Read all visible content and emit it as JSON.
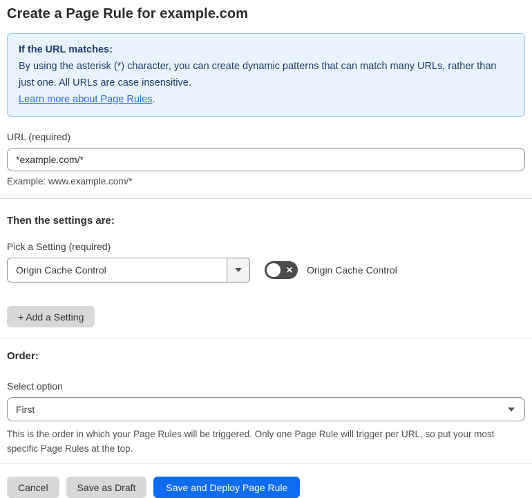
{
  "page": {
    "title": "Create a Page Rule for example.com"
  },
  "info_box": {
    "heading": "If the URL matches:",
    "body": "By using the asterisk (*) character, you can create dynamic patterns that can match many URLs, rather than just one. All URLs are case insensitive.",
    "link_label": "Learn more about Page Rules",
    "link_suffix": "."
  },
  "url_section": {
    "label": "URL (required)",
    "value": "*example.com/*",
    "helper": "Example: www.example.com/*"
  },
  "settings_section": {
    "heading": "Then the settings are:",
    "picker_label": "Pick a Setting (required)",
    "picker_value": "Origin Cache Control",
    "toggle_state": "off",
    "toggle_label": "Origin Cache Control",
    "add_button_label": "+ Add a Setting"
  },
  "order_section": {
    "heading": "Order:",
    "label": "Select option",
    "value": "First",
    "helper": "This is the order in which your Page Rules will be triggered. Only one Page Rule will trigger per URL, so put your most specific Page Rules at the top."
  },
  "footer": {
    "cancel_label": "Cancel",
    "save_draft_label": "Save as Draft",
    "save_deploy_label": "Save and Deploy Page Rule"
  },
  "colors": {
    "info_background": "#e9f3fb",
    "info_border": "#9cc7e8",
    "info_text": "#1e3c6e",
    "link": "#2e68d9",
    "primary_button": "#0f6cf0",
    "toggle_off": "#4d4d4d"
  }
}
